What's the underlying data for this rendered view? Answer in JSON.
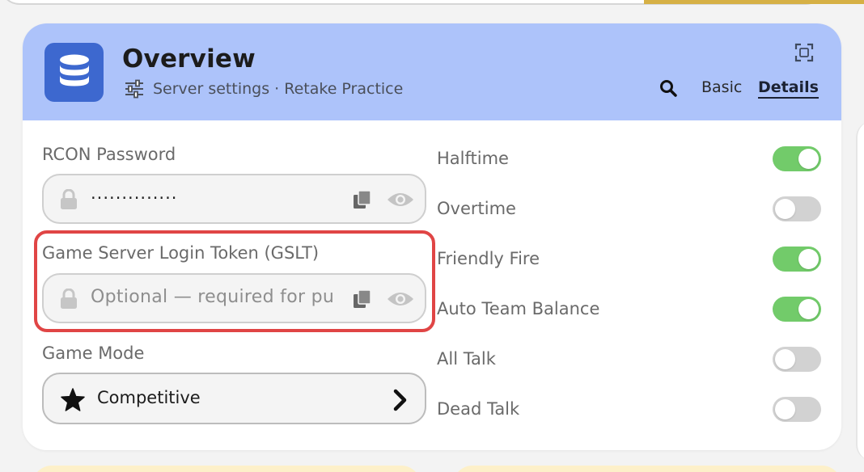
{
  "header": {
    "title": "Overview",
    "subtitle": "Server settings · Retake Practice",
    "tabs": [
      {
        "label": "Basic",
        "active": false
      },
      {
        "label": "Details",
        "active": true
      }
    ],
    "icons": {
      "app": "database-stack-icon",
      "subtitle": "sliders-icon",
      "search": "search-icon",
      "expand": "expand-icon"
    }
  },
  "fields": {
    "rcon": {
      "label": "RCON Password",
      "value": "··············"
    },
    "gslt": {
      "label": "Game Server Login Token (GSLT)",
      "placeholder": "Optional — required for public"
    },
    "mode": {
      "label": "Game Mode",
      "value": "Competitive"
    }
  },
  "toggles": [
    {
      "label": "Halftime",
      "on": true
    },
    {
      "label": "Overtime",
      "on": false
    },
    {
      "label": "Friendly Fire",
      "on": true
    },
    {
      "label": "Auto Team Balance",
      "on": true
    },
    {
      "label": "All Talk",
      "on": false
    },
    {
      "label": "Dead Talk",
      "on": false
    }
  ],
  "colors": {
    "header_bg": "#adc3fa",
    "accent": "#3d68cf",
    "toggle_on": "#72cb6a",
    "toggle_off": "#d2d2d2",
    "highlight": "#e04545"
  }
}
